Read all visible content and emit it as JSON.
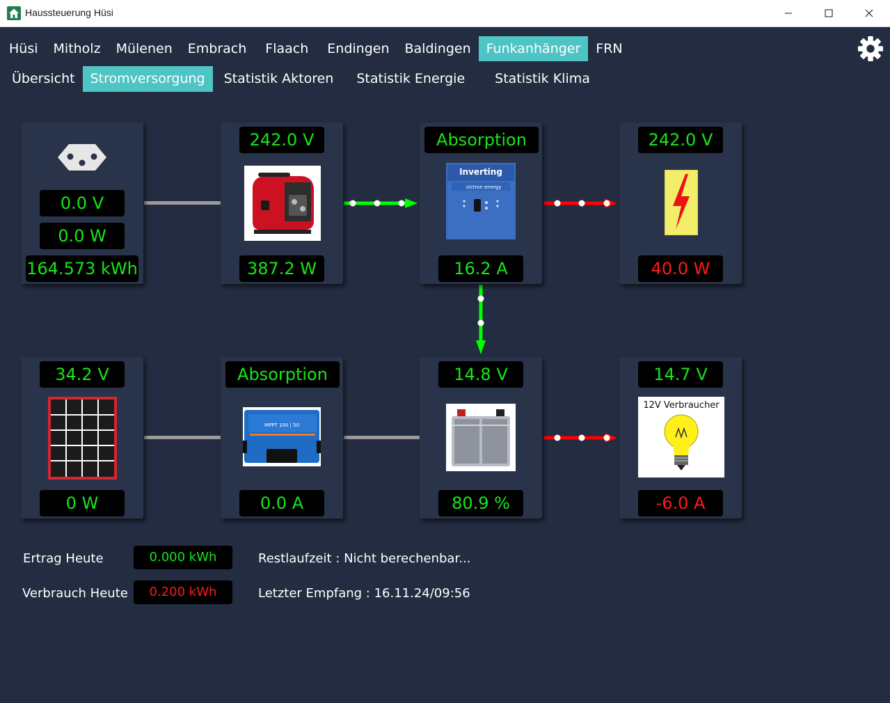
{
  "window": {
    "title": "Haussteuerung Hüsi",
    "controls": [
      "minimize",
      "maximize",
      "close"
    ]
  },
  "nav_main": [
    {
      "label": "Hüsi",
      "active": false
    },
    {
      "label": "Mitholz",
      "active": false
    },
    {
      "label": "Mülenen",
      "active": false
    },
    {
      "label": "Embrach",
      "active": false
    },
    {
      "label": "Flaach",
      "active": false
    },
    {
      "label": "Endingen",
      "active": false
    },
    {
      "label": "Baldingen",
      "active": false
    },
    {
      "label": "Funkanhänger",
      "active": true
    },
    {
      "label": "FRN",
      "active": false
    }
  ],
  "nav_sub": [
    {
      "label": "Übersicht",
      "active": false
    },
    {
      "label": "Stromversorgung",
      "active": true
    },
    {
      "label": "Statistik Aktoren",
      "active": false
    },
    {
      "label": "Statistik Energie",
      "active": false
    },
    {
      "label": "Statistik Klima",
      "active": false
    }
  ],
  "grid_card": {
    "icon": "swiss-socket-icon",
    "voltage": "0.0 V",
    "power": "0.0 W",
    "energy": "164.573 kWh"
  },
  "generator_card": {
    "icon": "generator-icon",
    "voltage": "242.0 V",
    "power": "387.2 W"
  },
  "inverter_card": {
    "icon": "victron-inverter-icon",
    "state": "Absorption",
    "current": "16.2 A",
    "device_text": "Inverting",
    "brand_text": "victron energy"
  },
  "ac_load_card": {
    "icon": "high-voltage-icon",
    "voltage": "242.0 V",
    "power": "40.0 W"
  },
  "solar_card": {
    "icon": "solar-panel-icon",
    "voltage": "34.2 V",
    "power": "0 W"
  },
  "mppt_card": {
    "icon": "mppt-charger-icon",
    "state": "Absorption",
    "current": "0.0 A",
    "device_text": "MPPT 100 | 50"
  },
  "battery_card": {
    "icon": "battery-icon",
    "voltage": "14.8 V",
    "soc": "80.9 %"
  },
  "dc_load_card": {
    "icon": "light-bulb-icon",
    "voltage": "14.7 V",
    "current": "-6.0 A",
    "image_label": "12V Verbraucher"
  },
  "summary": {
    "yield_label": "Ertrag Heute",
    "yield_value": "0.000 kWh",
    "consumption_label": "Verbrauch Heute",
    "consumption_value": "0.200 kWh",
    "runtime_text": "Restlaufzeit : Nicht berechenbar...",
    "last_receive_text": "Letzter Empfang : 16.11.24/09:56"
  },
  "colors": {
    "background": "#232c40",
    "card": "#29334a",
    "accent": "#4ec4c4",
    "value_green": "#17e617",
    "value_red": "#ff1a1a",
    "flow_green": "#00ff00",
    "flow_red": "#ff0000"
  }
}
